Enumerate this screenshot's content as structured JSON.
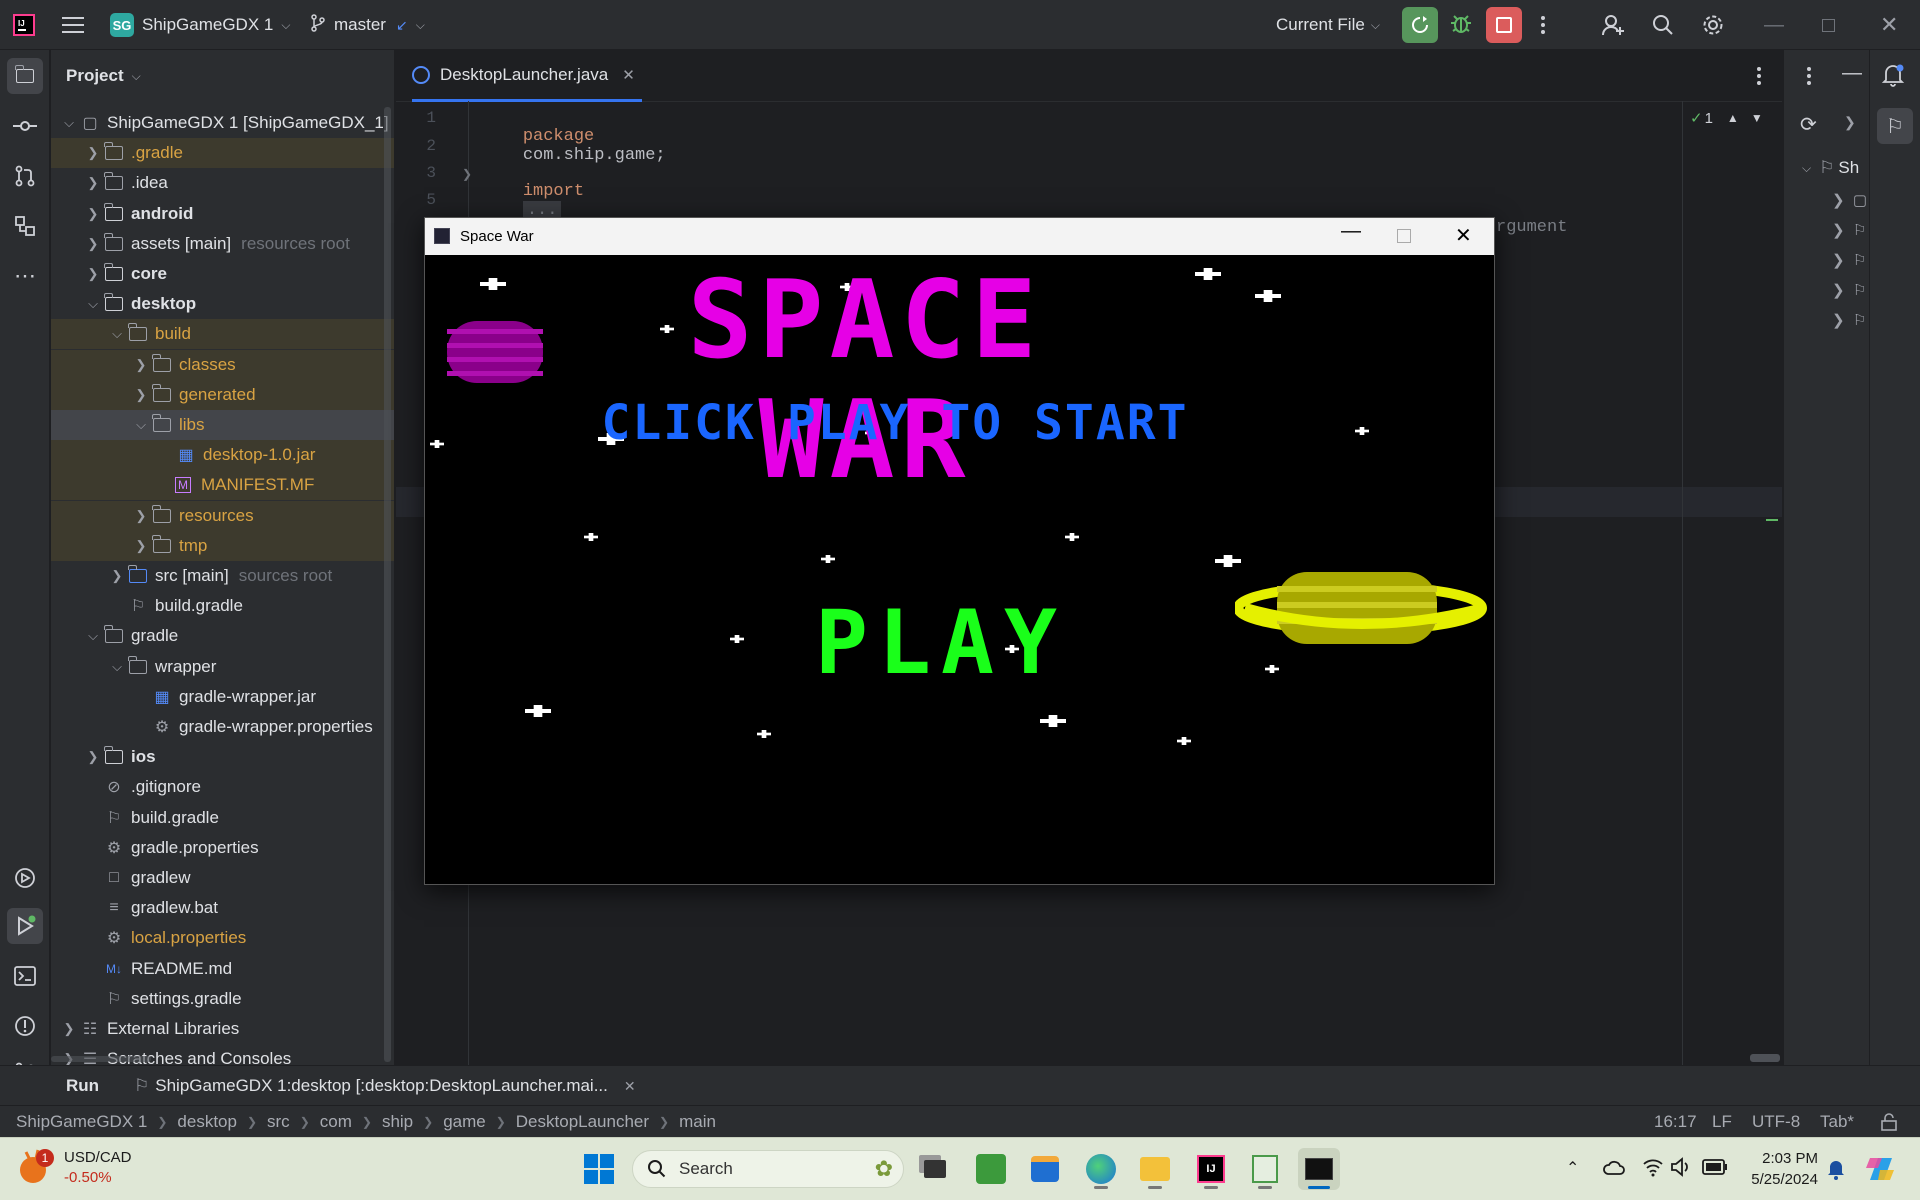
{
  "titlebar": {
    "project_badge": "SG",
    "project_name": "ShipGameGDX 1",
    "branch": "master",
    "run_config": "Current File"
  },
  "project_panel": {
    "title": "Project",
    "rows": [
      {
        "label": "ShipGameGDX 1 [ShipGameGDX_1]",
        "hint": "",
        "icon": "module-icon"
      },
      {
        "label": ".gradle",
        "hint": "",
        "icon": "folder-icon"
      },
      {
        "label": ".idea",
        "hint": "",
        "icon": "folder-icon"
      },
      {
        "label": "android",
        "hint": "",
        "icon": "module-folder-icon"
      },
      {
        "label": "assets [main]",
        "hint": "resources root",
        "icon": "resources-folder-icon"
      },
      {
        "label": "core",
        "hint": "",
        "icon": "module-folder-icon"
      },
      {
        "label": "desktop",
        "hint": "",
        "icon": "module-folder-icon"
      },
      {
        "label": "build",
        "hint": "",
        "icon": "folder-icon"
      },
      {
        "label": "classes",
        "hint": "",
        "icon": "folder-icon"
      },
      {
        "label": "generated",
        "hint": "",
        "icon": "folder-icon"
      },
      {
        "label": "libs",
        "hint": "",
        "icon": "folder-icon"
      },
      {
        "label": "desktop-1.0.jar",
        "hint": "",
        "icon": "jar-icon"
      },
      {
        "label": "MANIFEST.MF",
        "hint": "",
        "icon": "manifest-icon"
      },
      {
        "label": "resources",
        "hint": "",
        "icon": "folder-icon"
      },
      {
        "label": "tmp",
        "hint": "",
        "icon": "folder-icon"
      },
      {
        "label": "src [main]",
        "hint": "sources root",
        "icon": "source-folder-icon"
      },
      {
        "label": "build.gradle",
        "hint": "",
        "icon": "gradle-icon"
      },
      {
        "label": "gradle",
        "hint": "",
        "icon": "folder-icon"
      },
      {
        "label": "wrapper",
        "hint": "",
        "icon": "folder-icon"
      },
      {
        "label": "gradle-wrapper.jar",
        "hint": "",
        "icon": "jar-icon"
      },
      {
        "label": "gradle-wrapper.properties",
        "hint": "",
        "icon": "gear-icon"
      },
      {
        "label": "ios",
        "hint": "",
        "icon": "module-folder-icon"
      },
      {
        "label": ".gitignore",
        "hint": "",
        "icon": "ignore-icon"
      },
      {
        "label": "build.gradle",
        "hint": "",
        "icon": "gradle-icon"
      },
      {
        "label": "gradle.properties",
        "hint": "",
        "icon": "gear-icon"
      },
      {
        "label": "gradlew",
        "hint": "",
        "icon": "terminal-file-icon"
      },
      {
        "label": "gradlew.bat",
        "hint": "",
        "icon": "text-file-icon"
      },
      {
        "label": "local.properties",
        "hint": "",
        "icon": "gear-icon"
      },
      {
        "label": "README.md",
        "hint": "",
        "icon": "markdown-icon"
      },
      {
        "label": "settings.gradle",
        "hint": "",
        "icon": "gradle-icon"
      },
      {
        "label": "External Libraries",
        "hint": "",
        "icon": "library-icon"
      },
      {
        "label": "Scratches and Consoles",
        "hint": "",
        "icon": "scratch-icon"
      }
    ]
  },
  "editor": {
    "tab_label": "DesktopLauncher.java",
    "inspection_count": "1",
    "line_numbers": [
      "1",
      "2",
      "3",
      "5"
    ],
    "code_keyword": "package",
    "code_package": "com.ship.game;",
    "code_import_keyword": "import",
    "code_import_fold": "...",
    "code_fragment": "rgument"
  },
  "right_panel": {
    "gradle_root": "Sh"
  },
  "game": {
    "window_title": "Space War",
    "title": "SPACE WAR",
    "subtitle": "CLICK PLAY TO START",
    "play": "PLAY",
    "colors": {
      "title": "#e600e6",
      "subtitle": "#1a66ff",
      "play": "#1aff1a",
      "planet_left": "#990099",
      "planet_right": "#d4e01a"
    }
  },
  "run_bar": {
    "label": "Run",
    "config_tab": "ShipGameGDX 1:desktop [:desktop:DesktopLauncher.mai..."
  },
  "status_bar": {
    "breadcrumbs": [
      "ShipGameGDX 1",
      "desktop",
      "src",
      "com",
      "ship",
      "game",
      "DesktopLauncher",
      "main"
    ],
    "position": "16:17",
    "line_sep": "LF",
    "encoding": "UTF-8",
    "indent": "Tab*"
  },
  "taskbar": {
    "weather_badge": "1",
    "stock_name": "USD/CAD",
    "stock_change": "-0.50%",
    "search_placeholder": "Search",
    "time": "2:03 PM",
    "date": "5/25/2024"
  }
}
